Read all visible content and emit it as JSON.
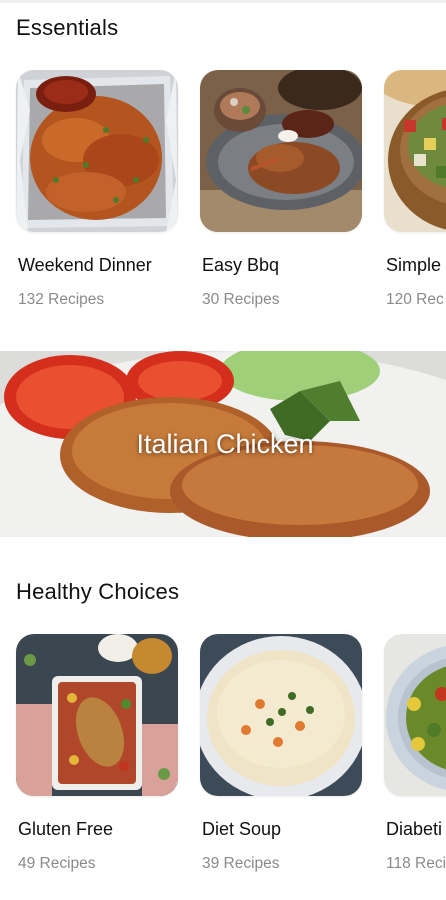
{
  "sections": [
    {
      "title": "Essentials",
      "cards": [
        {
          "title": "Weekend Dinner",
          "count": "132 Recipes",
          "image": "baked-chicken-foil-image"
        },
        {
          "title": "Easy Bbq",
          "count": "30 Recipes",
          "image": "pulled-pork-plate-image"
        },
        {
          "title": "Simple",
          "count": "120 Rec",
          "image": "salad-bowl-image"
        }
      ]
    },
    {
      "title": "Healthy Choices",
      "cards": [
        {
          "title": "Gluten Free",
          "count": "49 Recipes",
          "image": "chicken-vegetable-tray-image"
        },
        {
          "title": "Diet Soup",
          "count": "39 Recipes",
          "image": "creamy-soup-bowl-image"
        },
        {
          "title": "Diabeti",
          "count": "118 Reci",
          "image": "vegetable-bowl-image"
        }
      ]
    }
  ],
  "banner": {
    "label": "Italian Chicken",
    "image": "breaded-chicken-cutlet-image"
  },
  "colors": {
    "background": "#ffffff",
    "title": "#111111",
    "subtitle": "#8a8a8a",
    "banner_text": "#ffffff"
  }
}
